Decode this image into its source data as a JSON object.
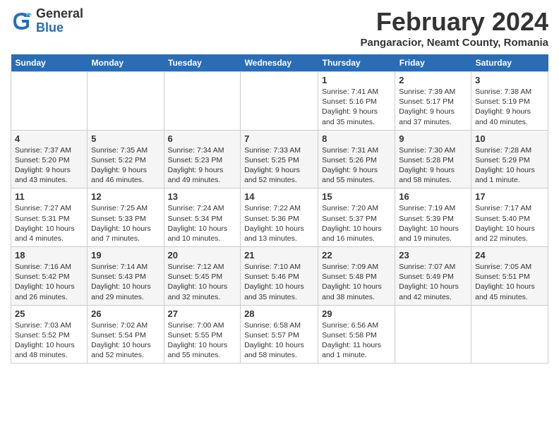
{
  "header": {
    "logo_general": "General",
    "logo_blue": "Blue",
    "month_title": "February 2024",
    "subtitle": "Pangaracior, Neamt County, Romania"
  },
  "weekdays": [
    "Sunday",
    "Monday",
    "Tuesday",
    "Wednesday",
    "Thursday",
    "Friday",
    "Saturday"
  ],
  "weeks": [
    [
      {
        "num": "",
        "info": ""
      },
      {
        "num": "",
        "info": ""
      },
      {
        "num": "",
        "info": ""
      },
      {
        "num": "",
        "info": ""
      },
      {
        "num": "1",
        "info": "Sunrise: 7:41 AM\nSunset: 5:16 PM\nDaylight: 9 hours\nand 35 minutes."
      },
      {
        "num": "2",
        "info": "Sunrise: 7:39 AM\nSunset: 5:17 PM\nDaylight: 9 hours\nand 37 minutes."
      },
      {
        "num": "3",
        "info": "Sunrise: 7:38 AM\nSunset: 5:19 PM\nDaylight: 9 hours\nand 40 minutes."
      }
    ],
    [
      {
        "num": "4",
        "info": "Sunrise: 7:37 AM\nSunset: 5:20 PM\nDaylight: 9 hours\nand 43 minutes."
      },
      {
        "num": "5",
        "info": "Sunrise: 7:35 AM\nSunset: 5:22 PM\nDaylight: 9 hours\nand 46 minutes."
      },
      {
        "num": "6",
        "info": "Sunrise: 7:34 AM\nSunset: 5:23 PM\nDaylight: 9 hours\nand 49 minutes."
      },
      {
        "num": "7",
        "info": "Sunrise: 7:33 AM\nSunset: 5:25 PM\nDaylight: 9 hours\nand 52 minutes."
      },
      {
        "num": "8",
        "info": "Sunrise: 7:31 AM\nSunset: 5:26 PM\nDaylight: 9 hours\nand 55 minutes."
      },
      {
        "num": "9",
        "info": "Sunrise: 7:30 AM\nSunset: 5:28 PM\nDaylight: 9 hours\nand 58 minutes."
      },
      {
        "num": "10",
        "info": "Sunrise: 7:28 AM\nSunset: 5:29 PM\nDaylight: 10 hours\nand 1 minute."
      }
    ],
    [
      {
        "num": "11",
        "info": "Sunrise: 7:27 AM\nSunset: 5:31 PM\nDaylight: 10 hours\nand 4 minutes."
      },
      {
        "num": "12",
        "info": "Sunrise: 7:25 AM\nSunset: 5:33 PM\nDaylight: 10 hours\nand 7 minutes."
      },
      {
        "num": "13",
        "info": "Sunrise: 7:24 AM\nSunset: 5:34 PM\nDaylight: 10 hours\nand 10 minutes."
      },
      {
        "num": "14",
        "info": "Sunrise: 7:22 AM\nSunset: 5:36 PM\nDaylight: 10 hours\nand 13 minutes."
      },
      {
        "num": "15",
        "info": "Sunrise: 7:20 AM\nSunset: 5:37 PM\nDaylight: 10 hours\nand 16 minutes."
      },
      {
        "num": "16",
        "info": "Sunrise: 7:19 AM\nSunset: 5:39 PM\nDaylight: 10 hours\nand 19 minutes."
      },
      {
        "num": "17",
        "info": "Sunrise: 7:17 AM\nSunset: 5:40 PM\nDaylight: 10 hours\nand 22 minutes."
      }
    ],
    [
      {
        "num": "18",
        "info": "Sunrise: 7:16 AM\nSunset: 5:42 PM\nDaylight: 10 hours\nand 26 minutes."
      },
      {
        "num": "19",
        "info": "Sunrise: 7:14 AM\nSunset: 5:43 PM\nDaylight: 10 hours\nand 29 minutes."
      },
      {
        "num": "20",
        "info": "Sunrise: 7:12 AM\nSunset: 5:45 PM\nDaylight: 10 hours\nand 32 minutes."
      },
      {
        "num": "21",
        "info": "Sunrise: 7:10 AM\nSunset: 5:46 PM\nDaylight: 10 hours\nand 35 minutes."
      },
      {
        "num": "22",
        "info": "Sunrise: 7:09 AM\nSunset: 5:48 PM\nDaylight: 10 hours\nand 38 minutes."
      },
      {
        "num": "23",
        "info": "Sunrise: 7:07 AM\nSunset: 5:49 PM\nDaylight: 10 hours\nand 42 minutes."
      },
      {
        "num": "24",
        "info": "Sunrise: 7:05 AM\nSunset: 5:51 PM\nDaylight: 10 hours\nand 45 minutes."
      }
    ],
    [
      {
        "num": "25",
        "info": "Sunrise: 7:03 AM\nSunset: 5:52 PM\nDaylight: 10 hours\nand 48 minutes."
      },
      {
        "num": "26",
        "info": "Sunrise: 7:02 AM\nSunset: 5:54 PM\nDaylight: 10 hours\nand 52 minutes."
      },
      {
        "num": "27",
        "info": "Sunrise: 7:00 AM\nSunset: 5:55 PM\nDaylight: 10 hours\nand 55 minutes."
      },
      {
        "num": "28",
        "info": "Sunrise: 6:58 AM\nSunset: 5:57 PM\nDaylight: 10 hours\nand 58 minutes."
      },
      {
        "num": "29",
        "info": "Sunrise: 6:56 AM\nSunset: 5:58 PM\nDaylight: 11 hours\nand 1 minute."
      },
      {
        "num": "",
        "info": ""
      },
      {
        "num": "",
        "info": ""
      }
    ]
  ]
}
